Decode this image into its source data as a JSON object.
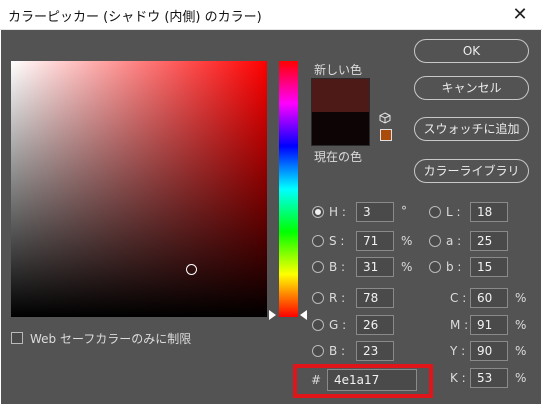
{
  "window": {
    "title": "カラーピッカー (シャドウ (内側) のカラー)",
    "close_glyph": "✕"
  },
  "buttons": {
    "ok": "OK",
    "cancel": "キャンセル",
    "add_to_swatches": "スウォッチに追加",
    "color_libraries": "カラーライブラリ"
  },
  "swatches": {
    "new_label": "新しい色",
    "current_label": "現在の色",
    "new_color": "#4e1a17",
    "current_color": "#0d0406",
    "gamut_warning_color": "#a84b0b"
  },
  "hsb": {
    "h": {
      "label": "H :",
      "value": "3",
      "unit": "°",
      "selected": true
    },
    "s": {
      "label": "S :",
      "value": "71",
      "unit": "%",
      "selected": false
    },
    "b": {
      "label": "B :",
      "value": "31",
      "unit": "%",
      "selected": false
    }
  },
  "rgb": {
    "r": {
      "label": "R :",
      "value": "78"
    },
    "g": {
      "label": "G :",
      "value": "26"
    },
    "b": {
      "label": "B :",
      "value": "23"
    }
  },
  "lab": {
    "l": {
      "label": "L :",
      "value": "18"
    },
    "a": {
      "label": "a :",
      "value": "25"
    },
    "b": {
      "label": "b :",
      "value": "15"
    }
  },
  "cmyk": {
    "c": {
      "label": "C :",
      "value": "60",
      "unit": "%"
    },
    "m": {
      "label": "M :",
      "value": "91",
      "unit": "%"
    },
    "y": {
      "label": "Y :",
      "value": "90",
      "unit": "%"
    },
    "k": {
      "label": "K :",
      "value": "53",
      "unit": "%"
    }
  },
  "hex": {
    "label": "#",
    "value": "4e1a17"
  },
  "web_safe": {
    "label": "Web セーフカラーのみに制限",
    "checked": false
  },
  "colors": {
    "dialog_bg": "#535353",
    "highlight": "#e0151a",
    "hue": "#ff0000"
  }
}
